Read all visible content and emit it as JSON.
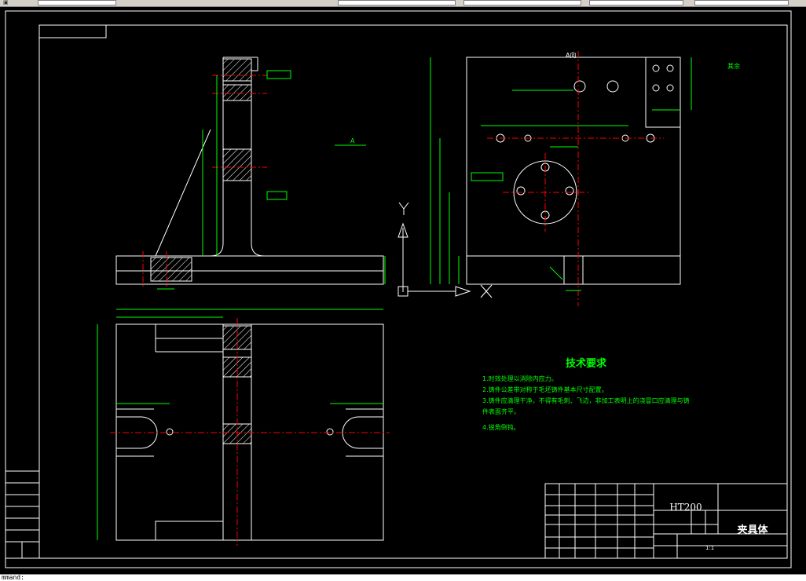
{
  "app": {
    "toolbar_icon": "app-icon",
    "command_prompt": "mmand: "
  },
  "drawing": {
    "view_label_a": "A向",
    "section_marker": "A",
    "surface_note": "其余",
    "axis_y": "Y",
    "axis_x": "X"
  },
  "tech_requirements": {
    "title": "技术要求",
    "items": [
      "1.时效处理以消除内应力。",
      "2.铸件公差带对称于毛坯铸件基本尺寸配置。",
      "3.铸件应清理干净，不得有毛刺、飞边，非加工表明上的浇冒口应清理与铸",
      "件表面齐平。",
      "4.锐角倒钝。"
    ]
  },
  "title_block": {
    "material": "HT200",
    "part_name": "夹具体",
    "scale": "1:1"
  },
  "colors": {
    "background": "#000000",
    "outline": "#ffffff",
    "dimension": "#00ff00",
    "centerline": "#ff0000",
    "hatch": "#ffffff"
  }
}
